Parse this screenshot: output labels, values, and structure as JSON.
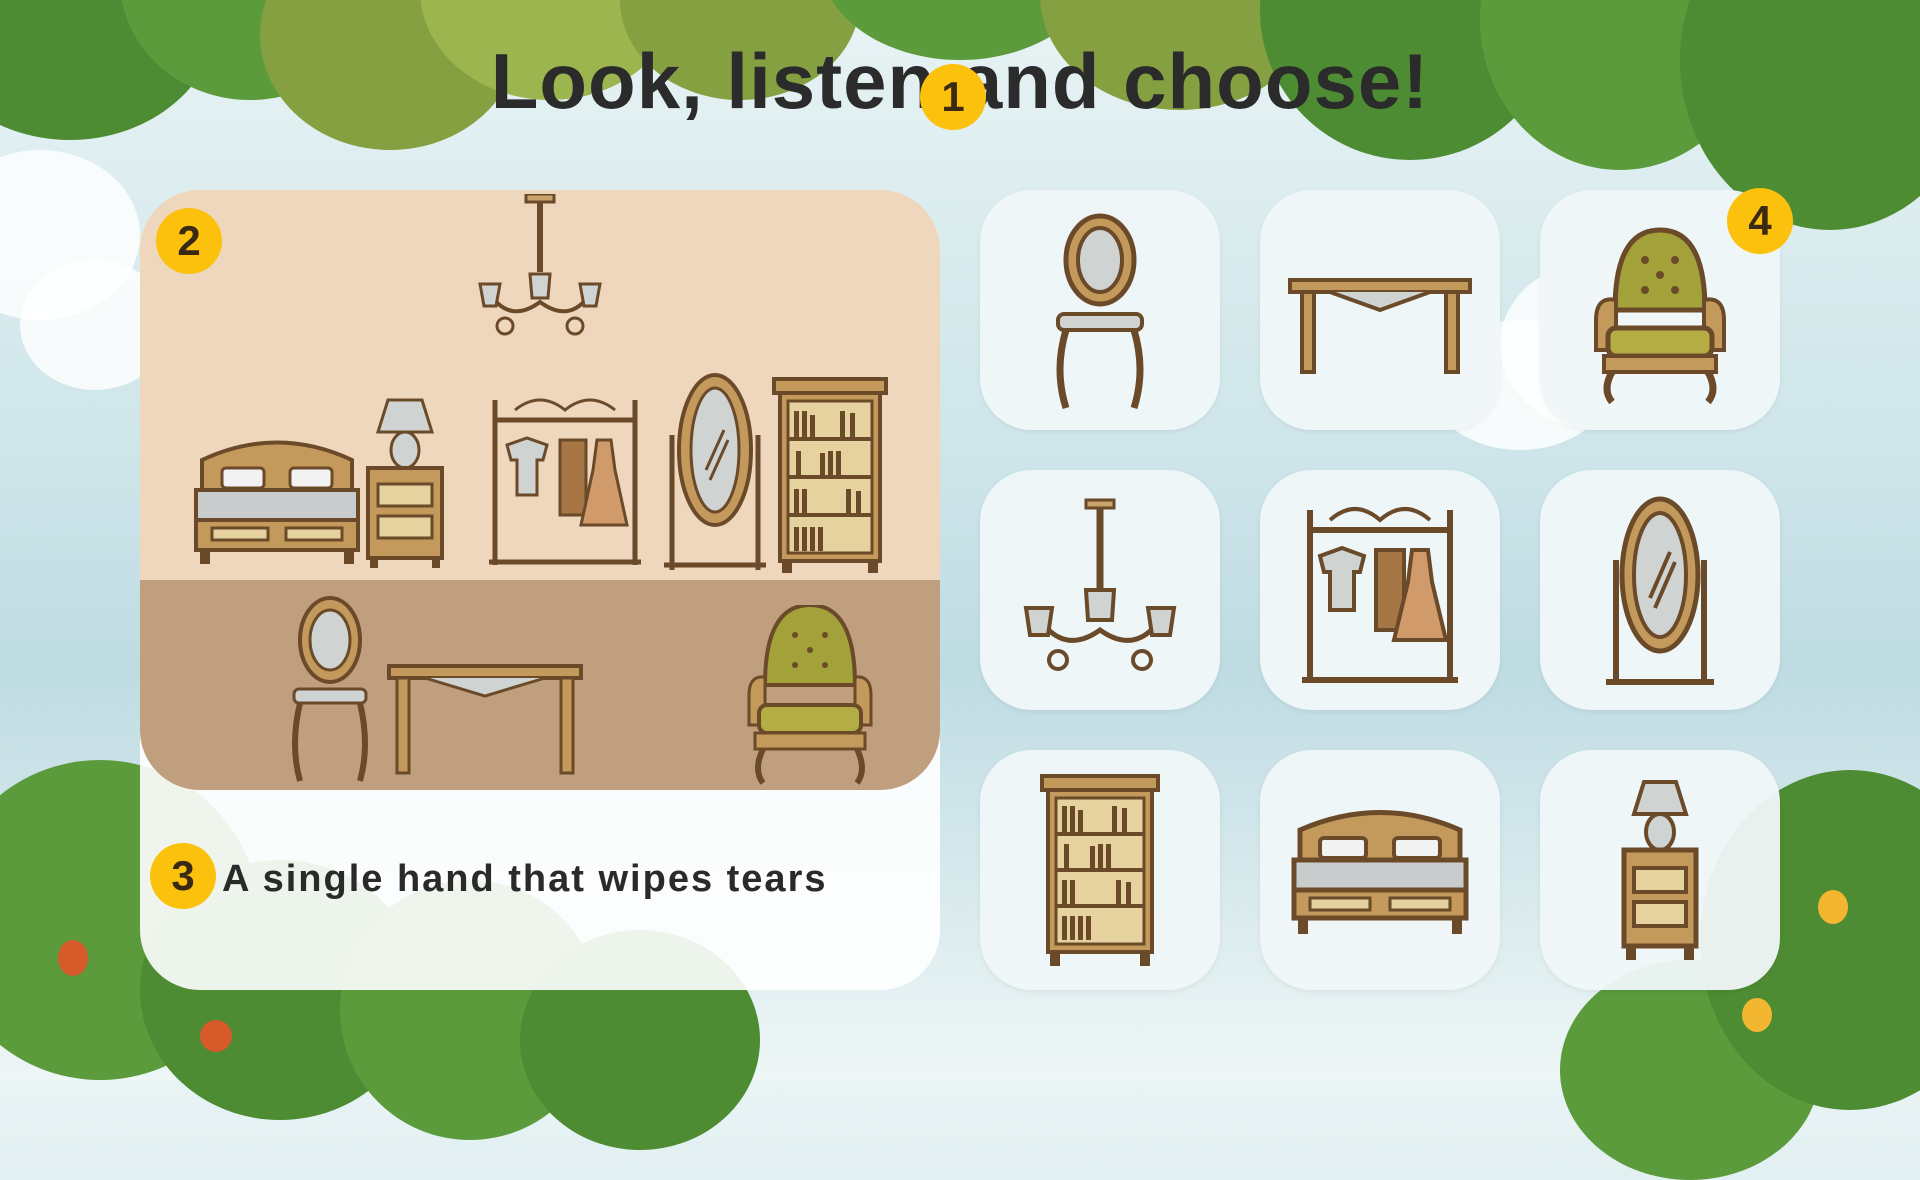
{
  "title": "Look, listen and choose!",
  "badges": {
    "b1": "1",
    "b2": "2",
    "b3": "3",
    "b4": "4"
  },
  "sentence": "A single hand that wipes tears",
  "choices": [
    {
      "icon": "chair-icon"
    },
    {
      "icon": "table-icon"
    },
    {
      "icon": "armchair-icon"
    },
    {
      "icon": "chandelier-icon"
    },
    {
      "icon": "clothes-rack-icon"
    },
    {
      "icon": "mirror-icon"
    },
    {
      "icon": "bookshelf-icon"
    },
    {
      "icon": "bed-icon"
    },
    {
      "icon": "nightstand-lamp-icon"
    }
  ],
  "colors": {
    "badge": "#fcc10d",
    "wood": "#8b5e34",
    "foliage": "#5b9b3c"
  }
}
